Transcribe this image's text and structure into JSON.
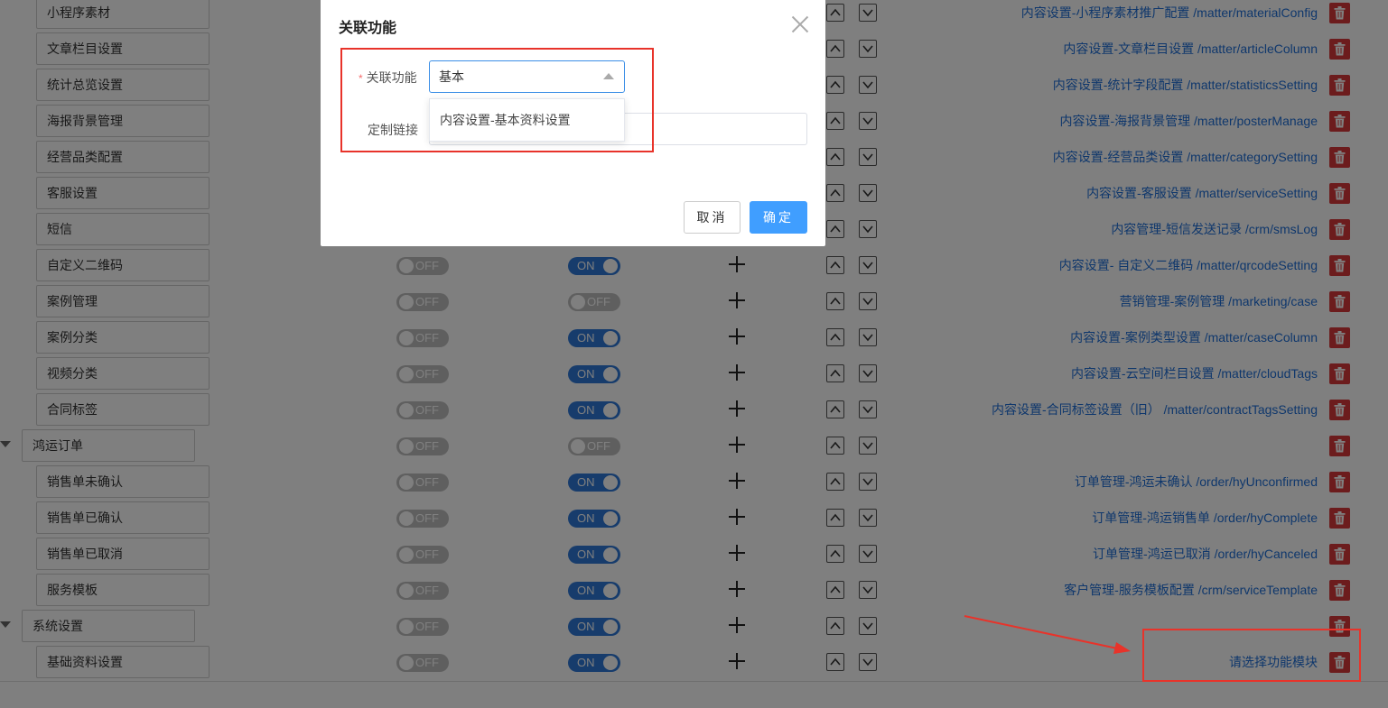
{
  "rows": [
    {
      "name": "小程序素材",
      "level": "child",
      "switch1": "",
      "switch2": "",
      "plus": false,
      "arrows": true,
      "link": "内容设置-小程序素材推广配置 /matter/materialConfig"
    },
    {
      "name": "文章栏目设置",
      "level": "child",
      "switch1": "",
      "switch2": "",
      "plus": false,
      "arrows": true,
      "link": "内容设置-文章栏目设置 /matter/articleColumn"
    },
    {
      "name": "统计总览设置",
      "level": "child",
      "switch1": "",
      "switch2": "",
      "plus": false,
      "arrows": true,
      "link": "内容设置-统计字段配置 /matter/statisticsSetting"
    },
    {
      "name": "海报背景管理",
      "level": "child",
      "switch1": "",
      "switch2": "",
      "plus": false,
      "arrows": true,
      "link": "内容设置-海报背景管理 /matter/posterManage"
    },
    {
      "name": "经营品类配置",
      "level": "child",
      "switch1": "",
      "switch2": "",
      "plus": false,
      "arrows": true,
      "link": "内容设置-经营品类设置 /matter/categorySetting"
    },
    {
      "name": "客服设置",
      "level": "child",
      "switch1": "",
      "switch2": "",
      "plus": false,
      "arrows": true,
      "link": "内容设置-客服设置 /matter/serviceSetting"
    },
    {
      "name": "短信",
      "level": "child",
      "switch1": "",
      "switch2": "",
      "plus": false,
      "arrows": true,
      "link": "内容管理-短信发送记录 /crm/smsLog"
    },
    {
      "name": "自定义二维码",
      "level": "child",
      "switch1": "OFF",
      "switch2": "ON",
      "plus": true,
      "arrows": true,
      "link": "内容设置- 自定义二维码 /matter/qrcodeSetting"
    },
    {
      "name": "案例管理",
      "level": "child",
      "switch1": "OFF",
      "switch2": "OFF",
      "plus": true,
      "arrows": true,
      "link": "营销管理-案例管理 /marketing/case"
    },
    {
      "name": "案例分类",
      "level": "child",
      "switch1": "OFF",
      "switch2": "ON",
      "plus": true,
      "arrows": true,
      "link": "内容设置-案例类型设置 /matter/caseColumn"
    },
    {
      "name": "视频分类",
      "level": "child",
      "switch1": "OFF",
      "switch2": "ON",
      "plus": true,
      "arrows": true,
      "link": "内容设置-云空间栏目设置 /matter/cloudTags"
    },
    {
      "name": "合同标签",
      "level": "child",
      "switch1": "OFF",
      "switch2": "ON",
      "plus": true,
      "arrows": true,
      "link": "内容设置-合同标签设置（旧） /matter/contractTagsSetting"
    },
    {
      "name": "鸿运订单",
      "level": "parent",
      "switch1": "OFF",
      "switch2": "OFF",
      "plus": true,
      "arrows": true,
      "link": ""
    },
    {
      "name": "销售单未确认",
      "level": "child",
      "switch1": "OFF",
      "switch2": "ON",
      "plus": true,
      "arrows": true,
      "link": "订单管理-鸿运未确认 /order/hyUnconfirmed"
    },
    {
      "name": "销售单已确认",
      "level": "child",
      "switch1": "OFF",
      "switch2": "ON",
      "plus": true,
      "arrows": true,
      "link": "订单管理-鸿运销售单 /order/hyComplete"
    },
    {
      "name": "销售单已取消",
      "level": "child",
      "switch1": "OFF",
      "switch2": "ON",
      "plus": true,
      "arrows": true,
      "link": "订单管理-鸿运已取消 /order/hyCanceled"
    },
    {
      "name": "服务模板",
      "level": "child",
      "switch1": "OFF",
      "switch2": "ON",
      "plus": true,
      "arrows": true,
      "link": "客户管理-服务模板配置 /crm/serviceTemplate"
    },
    {
      "name": "系统设置",
      "level": "parent",
      "switch1": "OFF",
      "switch2": "ON",
      "plus": true,
      "arrows": true,
      "link": ""
    },
    {
      "name": "基础资料设置",
      "level": "child",
      "switch1": "OFF",
      "switch2": "ON",
      "plus": true,
      "arrows": true,
      "link": "请选择功能模块"
    }
  ],
  "dialog": {
    "title": "关联功能",
    "required_mark": "*",
    "field1_label": "关联功能",
    "field1_value": "基本",
    "field2_label": "定制链接",
    "field2_value": "",
    "dropdown_option": "内容设置-基本资料设置",
    "cancel_label": "取消",
    "ok_label": "确定"
  },
  "colors": {
    "link": "#1e6fd9",
    "switch_on": "#2f78d8",
    "switch_off": "#bfbfbf",
    "delete": "#d9393a",
    "primary": "#409eff",
    "annotation": "#e8332a"
  }
}
